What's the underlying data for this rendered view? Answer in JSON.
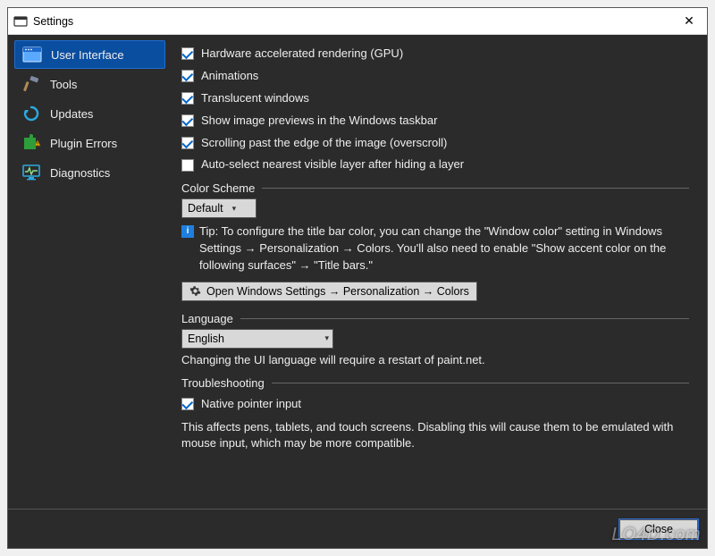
{
  "window": {
    "title": "Settings",
    "close_glyph": "✕"
  },
  "sidebar": {
    "items": [
      {
        "label": "User Interface",
        "icon": "window-icon",
        "selected": true
      },
      {
        "label": "Tools",
        "icon": "hammer-icon",
        "selected": false
      },
      {
        "label": "Updates",
        "icon": "refresh-icon",
        "selected": false
      },
      {
        "label": "Plugin Errors",
        "icon": "puzzle-warn-icon",
        "selected": false
      },
      {
        "label": "Diagnostics",
        "icon": "monitor-icon",
        "selected": false
      }
    ]
  },
  "main": {
    "checkboxes": [
      {
        "label": "Hardware accelerated rendering (GPU)",
        "checked": true
      },
      {
        "label": "Animations",
        "checked": true
      },
      {
        "label": "Translucent windows",
        "checked": true
      },
      {
        "label": "Show image previews in the Windows taskbar",
        "checked": true
      },
      {
        "label": "Scrolling past the edge of the image (overscroll)",
        "checked": true
      },
      {
        "label": "Auto-select nearest visible layer after hiding a layer",
        "checked": false
      }
    ],
    "color_scheme": {
      "header": "Color Scheme",
      "value": "Default",
      "tip": "Tip: To configure the title bar color, you can change the \"Window color\" setting in Windows Settings → Personalization → Colors. You'll also need to enable \"Show accent color on the following surfaces\" → \"Title bars.\"",
      "button_label": "Open Windows Settings → Personalization → Colors"
    },
    "language": {
      "header": "Language",
      "value": "English",
      "note": "Changing the UI language will require a restart of paint.net."
    },
    "troubleshooting": {
      "header": "Troubleshooting",
      "checkbox": {
        "label": "Native pointer input",
        "checked": true
      },
      "note": "This affects pens, tablets, and touch screens. Disabling this will cause them to be emulated with mouse input, which may be more compatible."
    }
  },
  "footer": {
    "close_label": "Close"
  },
  "watermark": "LO4D.com"
}
